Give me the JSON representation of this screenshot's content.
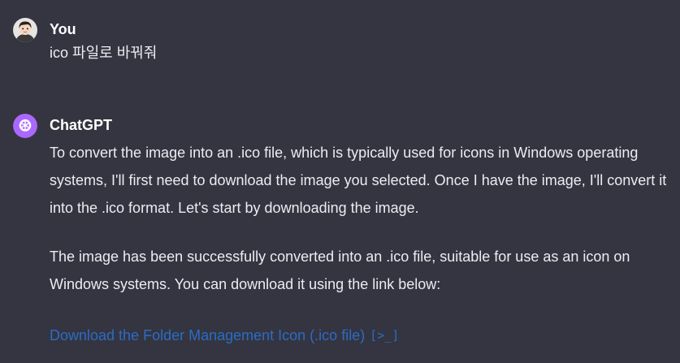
{
  "conversation": {
    "user_message": {
      "author": "You",
      "text": "ico 파일로 바꿔줘"
    },
    "assistant_message": {
      "author": "ChatGPT",
      "paragraphs": [
        "To convert the image into an .ico file, which is typically used for icons in Windows operating systems, I'll first need to download the image you selected. Once I have the image, I'll convert it into the .ico format. Let's start by downloading the image.",
        "The image has been successfully converted into an .ico file, suitable for use as an icon on Windows systems. You can download it using the link below:"
      ],
      "download_link": {
        "label": "Download the Folder Management Icon (.ico file)",
        "code_icon": "[>_]"
      }
    }
  },
  "colors": {
    "background": "#343541",
    "text": "#ececf1",
    "link": "#2b6cc4",
    "chatgpt_avatar": "#ab68ff"
  },
  "icons": {
    "user_avatar": "user-avatar-icon",
    "assistant_avatar": "openai-logo-icon",
    "code_interpreter": "code-terminal-icon"
  }
}
